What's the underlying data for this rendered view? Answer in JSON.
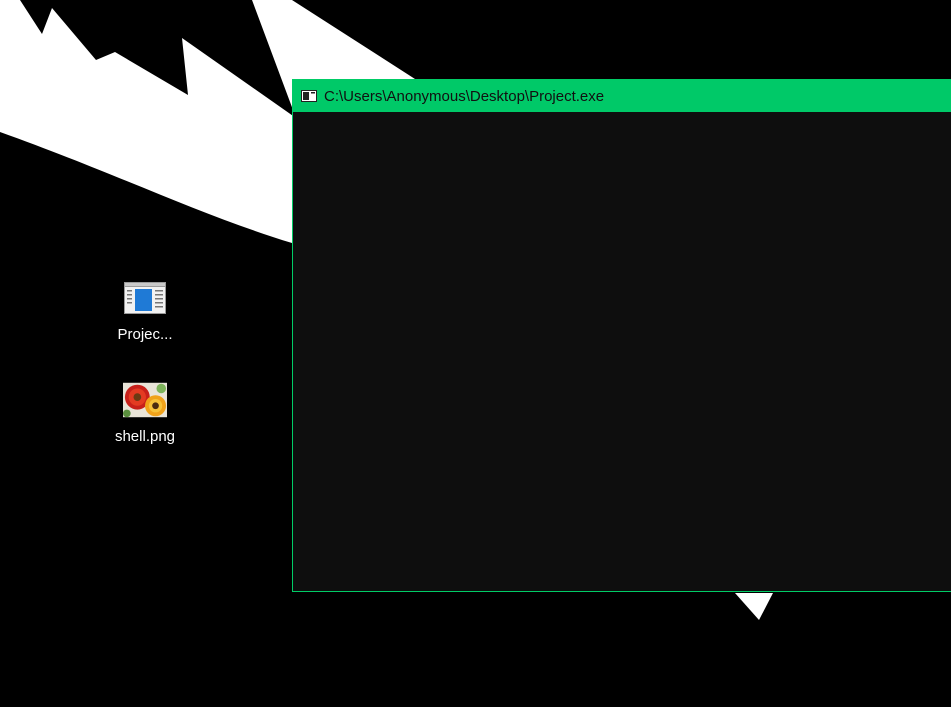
{
  "desktop": {
    "background_color": "#000000",
    "wallpaper_accent": "#ffffff",
    "icons": [
      {
        "label": "Projec...",
        "icon": "application-window-icon"
      },
      {
        "label": "shell.png",
        "icon": "flower-image-icon"
      }
    ]
  },
  "window": {
    "title": "C:\\Users\\Anonymous\\Desktop\\Project.exe",
    "icon": "console-app-icon",
    "titlebar_color": "#00c968",
    "body_color": "#0e0e0e",
    "console_text": ""
  }
}
